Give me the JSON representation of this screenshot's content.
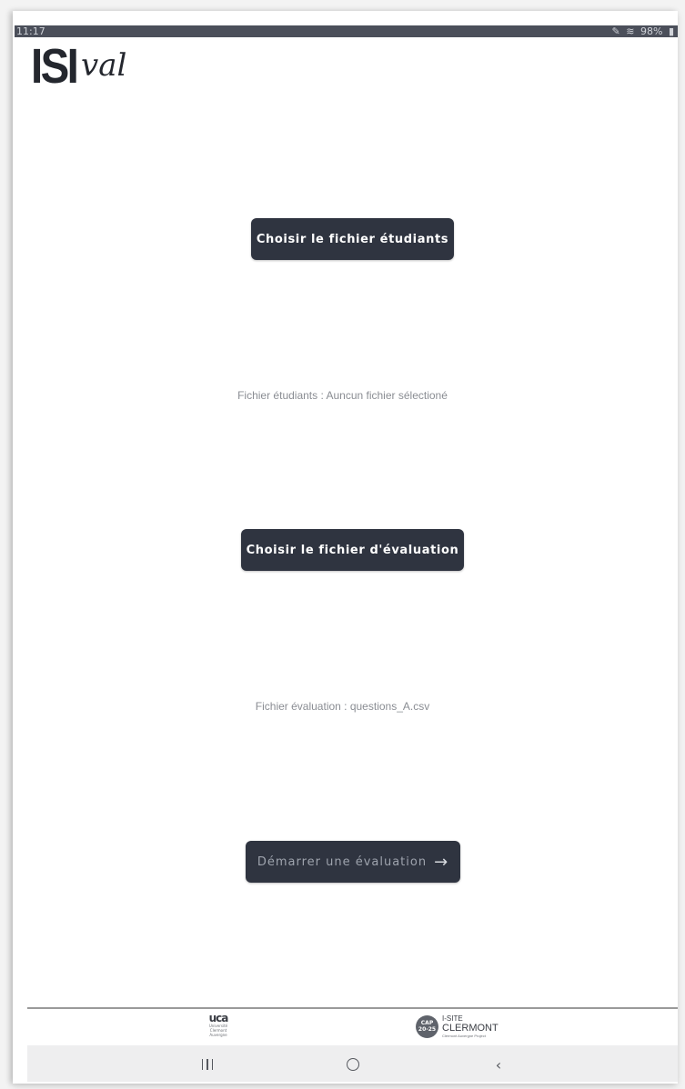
{
  "status_bar": {
    "time": "11:17",
    "battery": "98%",
    "icons": [
      "nfc-icon",
      "wifi-icon",
      "battery-icon"
    ]
  },
  "logo": {
    "isi": "ISI",
    "val": "val"
  },
  "buttons": {
    "students": "Choisir le fichier étudiants",
    "evaluation": "Choisir le fichier d'évaluation",
    "start": "Démarrer une évaluation",
    "start_icon": "arrow-right-icon"
  },
  "status": {
    "students": "Fichier étudiants : Auncun fichier sélectioné",
    "evaluation": "Fichier évaluation : questions_A.csv"
  },
  "footer": {
    "uca_mark": "uca",
    "uca_sub1": "Université",
    "uca_sub2": "Clermont",
    "uca_sub3": "Auvergne",
    "isite_badge1": "CAP",
    "isite_badge2": "20-25",
    "isite_line1": "I-SITE",
    "isite_line2": "CLERMONT",
    "isite_line3": "Clermont Auvergne Project"
  },
  "nav": {
    "icons": [
      "recents-icon",
      "home-icon",
      "back-icon"
    ]
  },
  "colors": {
    "button_bg": "#2f3440",
    "status_text": "#8a8d93",
    "status_bar": "#4b4f5a"
  }
}
